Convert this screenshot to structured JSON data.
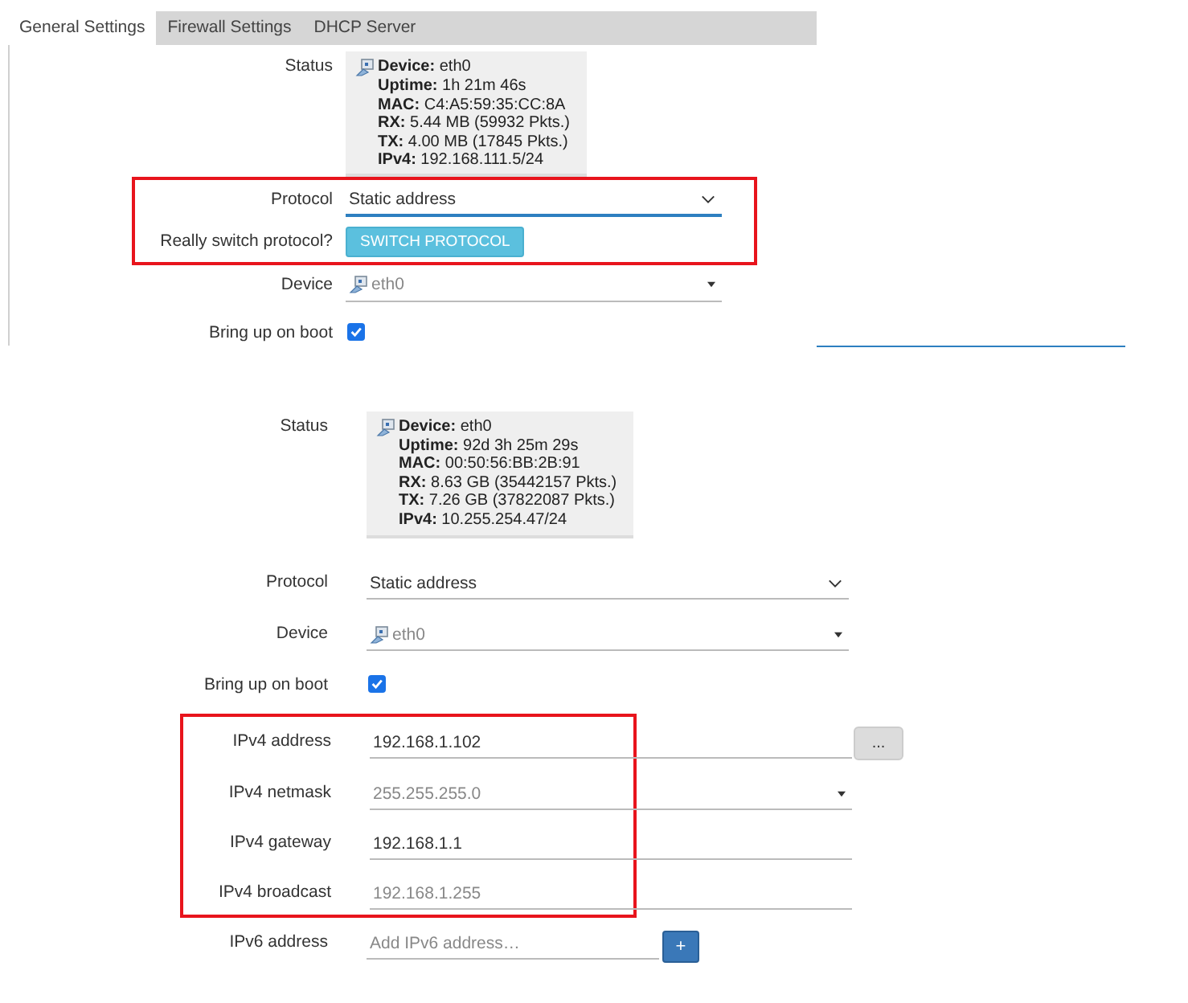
{
  "panels": [
    {
      "tabs": [
        {
          "label": "General Settings",
          "selected": true
        },
        {
          "label": "Firewall Settings",
          "selected": false
        },
        {
          "label": "DHCP Server",
          "selected": false
        }
      ],
      "sections": [
        {
          "highlighted": false,
          "fields": [
            {
              "kind": "status",
              "label": "Status",
              "lines": [
                {
                  "key": "Device:",
                  "value": "eth0"
                },
                {
                  "key": "Uptime:",
                  "value": "1h 21m 46s"
                },
                {
                  "key": "MAC:",
                  "value": "C4:A5:59:35:CC:8A"
                },
                {
                  "key": "RX:",
                  "value": "5.44 MB (59932 Pkts.)"
                },
                {
                  "key": "TX:",
                  "value": "4.00 MB (17845 Pkts.)"
                },
                {
                  "key": "IPv4:",
                  "value": "192.168.111.5/24"
                }
              ]
            }
          ]
        },
        {
          "highlighted": true,
          "fields": [
            {
              "kind": "select",
              "label": "Protocol",
              "value": "Static address",
              "focused": true
            },
            {
              "kind": "button",
              "label": "Really switch protocol?",
              "button": "SWITCH PROTOCOL"
            }
          ]
        },
        {
          "highlighted": false,
          "fields": [
            {
              "kind": "device",
              "label": "Device",
              "value": "eth0"
            },
            {
              "kind": "checkbox",
              "label": "Bring up on boot",
              "checked": true
            }
          ]
        }
      ]
    },
    {
      "sections": [
        {
          "highlighted": false,
          "fields": [
            {
              "kind": "status",
              "label": "Status",
              "lines": [
                {
                  "key": "Device:",
                  "value": "eth0"
                },
                {
                  "key": "Uptime:",
                  "value": "92d 3h 25m 29s"
                },
                {
                  "key": "MAC:",
                  "value": "00:50:56:BB:2B:91"
                },
                {
                  "key": "RX:",
                  "value": "8.63 GB (35442157 Pkts.)"
                },
                {
                  "key": "TX:",
                  "value": "7.26 GB (37822087 Pkts.)"
                },
                {
                  "key": "IPv4:",
                  "value": "10.255.254.47/24"
                }
              ]
            },
            {
              "kind": "select",
              "label": "Protocol",
              "value": "Static address",
              "focused": false
            },
            {
              "kind": "device",
              "label": "Device",
              "value": "eth0"
            },
            {
              "kind": "checkbox",
              "label": "Bring up on boot",
              "checked": true
            }
          ]
        },
        {
          "highlighted": true,
          "fields": [
            {
              "kind": "input",
              "label": "IPv4 address",
              "value": "192.168.1.102",
              "action": "..."
            },
            {
              "kind": "combo",
              "label": "IPv4 netmask",
              "placeholder": "255.255.255.0"
            },
            {
              "kind": "input",
              "label": "IPv4 gateway",
              "value": "192.168.1.1"
            },
            {
              "kind": "input",
              "label": "IPv4 broadcast",
              "placeholder": "192.168.1.255"
            }
          ]
        },
        {
          "highlighted": false,
          "fields": [
            {
              "kind": "list",
              "label": "IPv6 address",
              "placeholder": "Add IPv6 address…",
              "button": "+"
            }
          ]
        }
      ]
    }
  ]
}
